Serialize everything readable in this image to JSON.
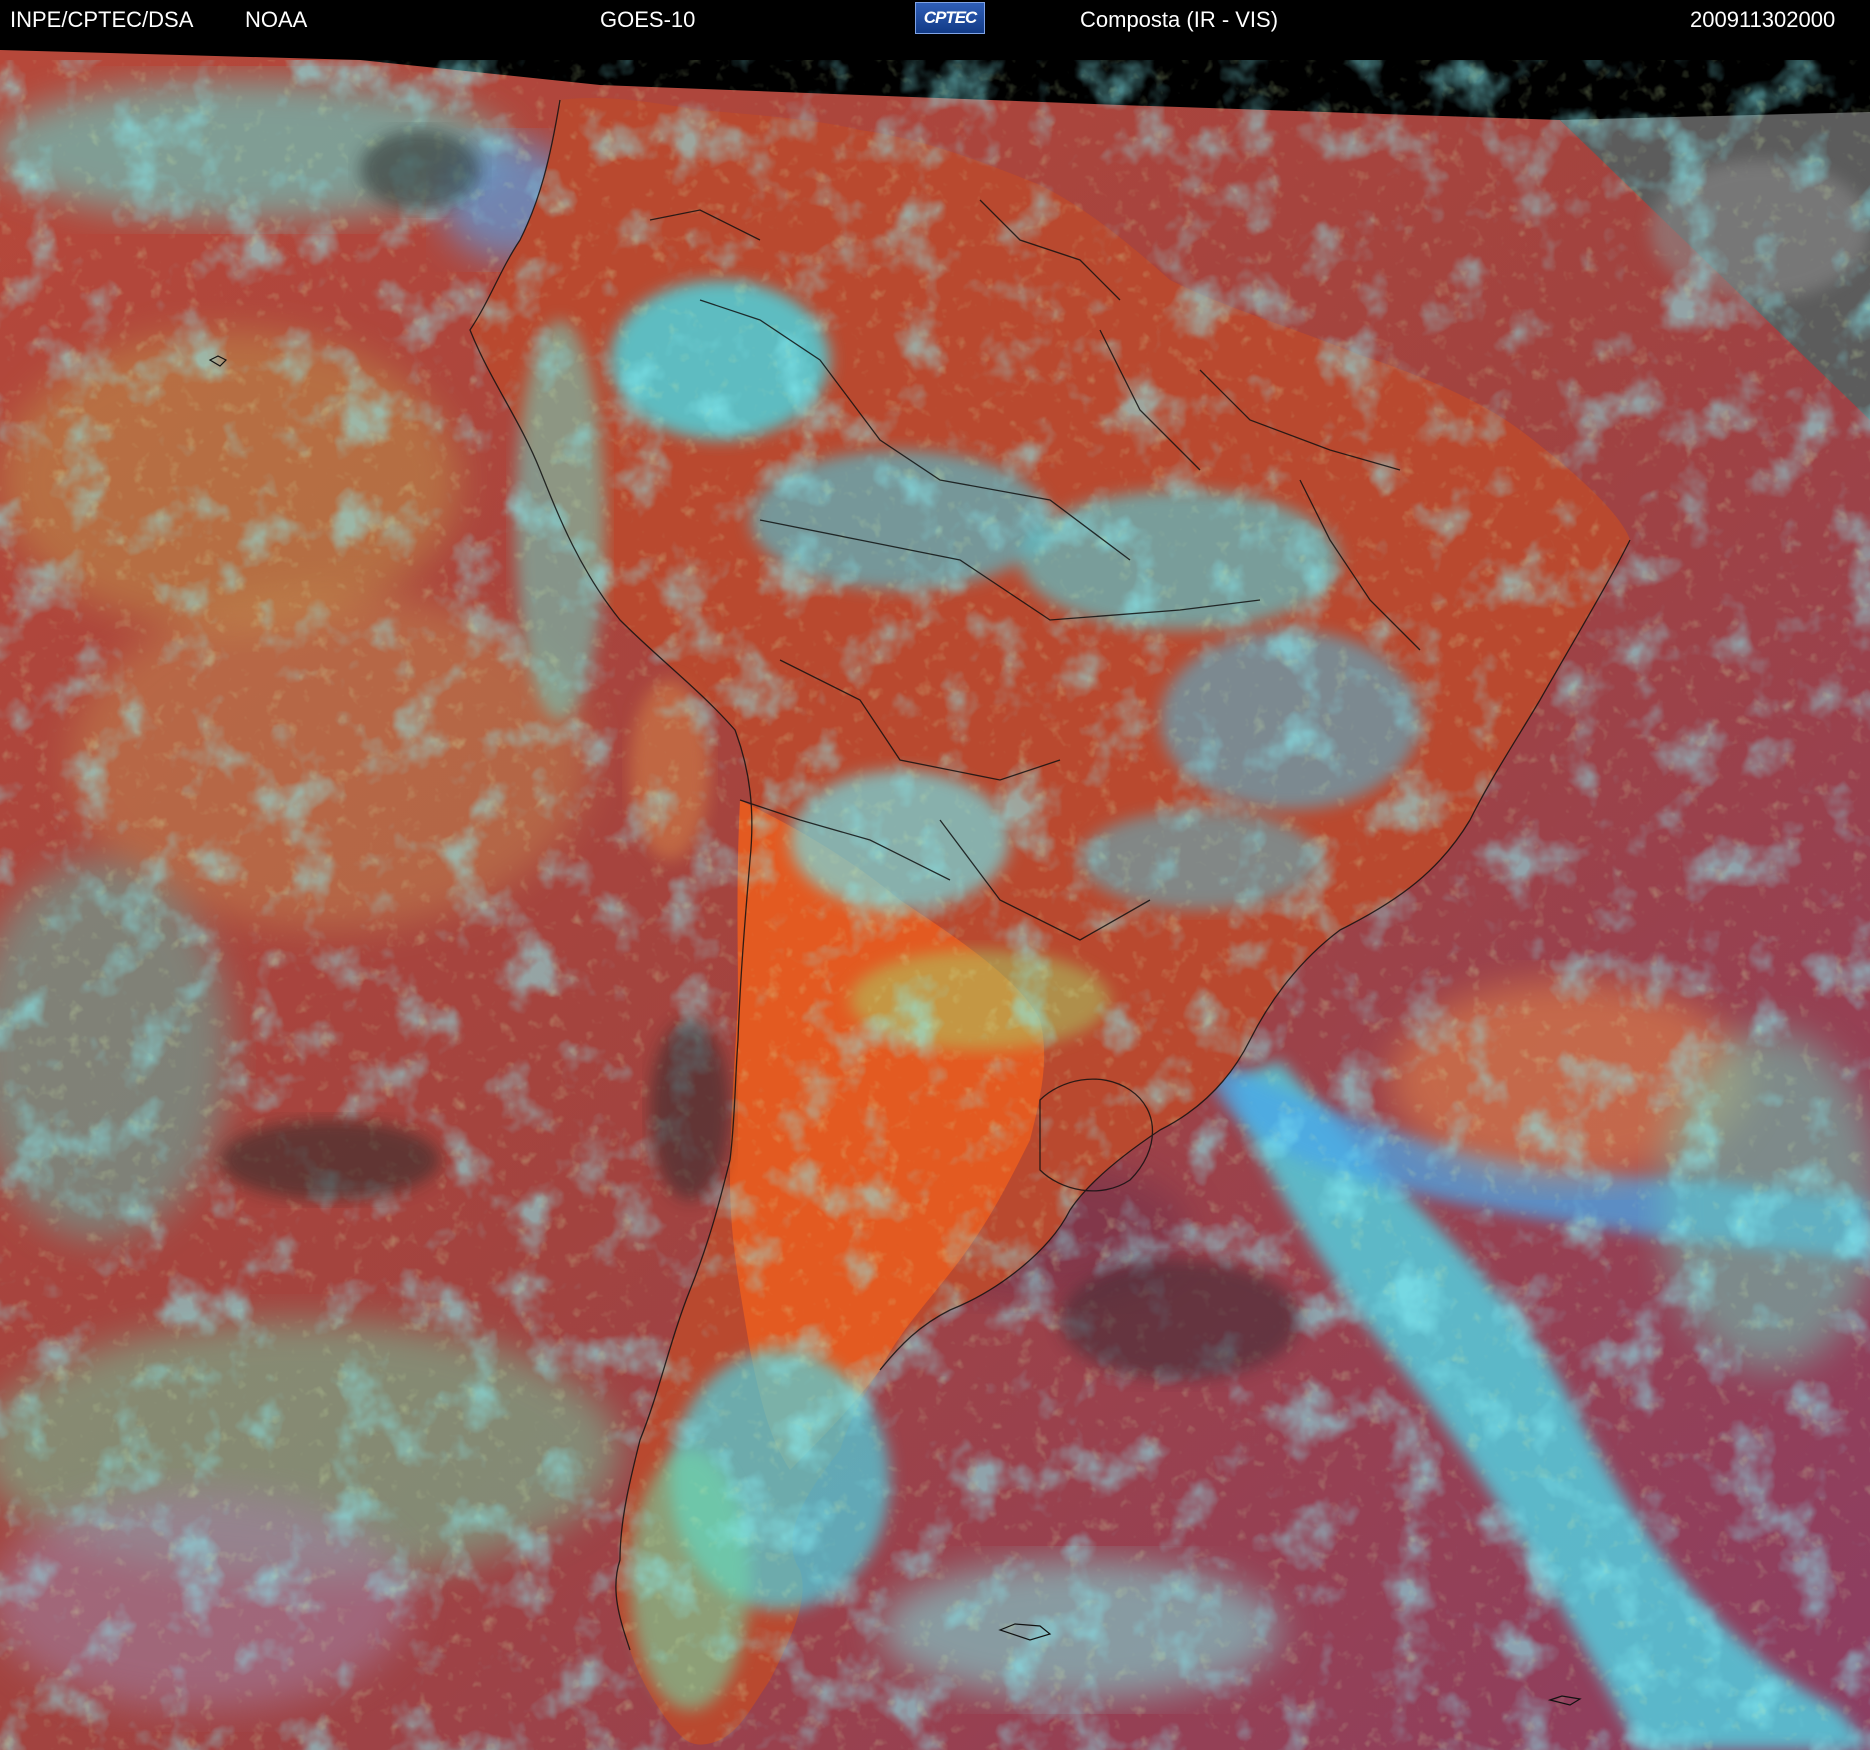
{
  "header": {
    "agency": "INPE/CPTEC/DSA",
    "source": "NOAA",
    "satellite": "GOES-10",
    "logo": "CPTEC",
    "product": "Composta (IR - VIS)",
    "timestamp": "200911302000"
  },
  "colors": {
    "background": "#000000",
    "land_red": "#b44a32",
    "ocean_magenta": "#9b3f5c",
    "cloud_cyan": "#3fe6f2",
    "cloud_green": "#9fd46a",
    "argentina_orange": "#e0581f",
    "unprocessed_gray": "#5a5a5a"
  }
}
